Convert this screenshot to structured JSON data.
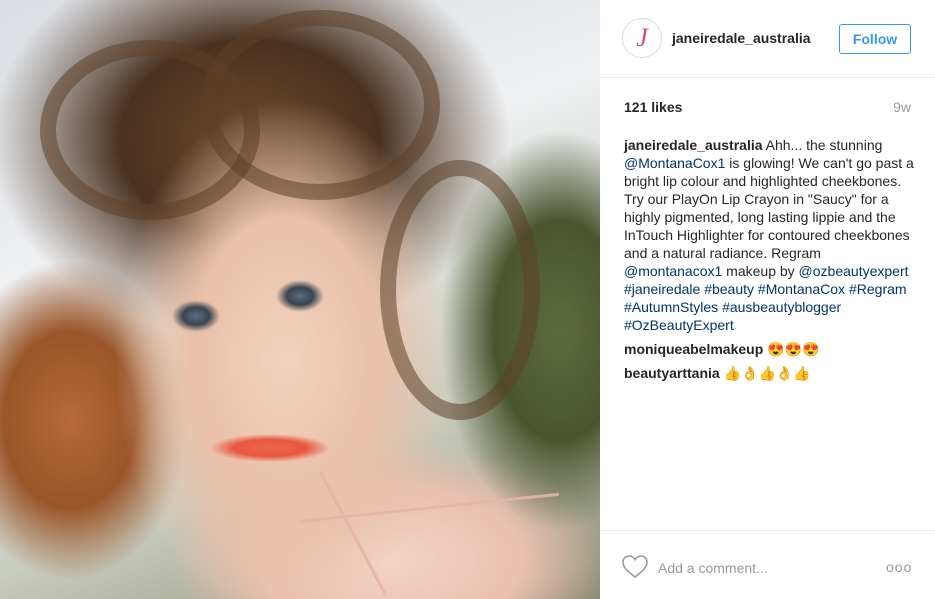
{
  "post": {
    "username": "janeiredale_australia",
    "follow_label": "Follow",
    "likes": "121 likes",
    "age": "9w"
  },
  "caption": {
    "author": "janeiredale_australia",
    "t1": " Ahh... the stunning ",
    "m1": "@MontanaCox1",
    "t2": " is glowing! We can't go past a bright lip colour and highlighted cheekbones. Try our PlayOn Lip Crayon in \"Saucy\" for a highly pigmented, long lasting lippie and the InTouch Highlighter for contoured cheekbones and a natural radiance. Regram ",
    "m2": "@montanacox1",
    "t3": " makeup by ",
    "m3": "@ozbeautyexpert",
    "h1": "#janeiredale",
    "h2": "#beauty",
    "h3": "#MontanaCox",
    "h4": "#Regram",
    "h5": "#AutumnStyles",
    "h6": "#ausbeautyblogger",
    "h7": "#OzBeautyExpert"
  },
  "comments": [
    {
      "author": "moniqueabelmakeup",
      "text": "😍😍😍"
    },
    {
      "author": "beautyarttania",
      "text": "👍👌👍👌👍"
    }
  ],
  "footer": {
    "placeholder": "Add a comment...",
    "more": "ooo"
  },
  "colors": {
    "follow": "#3897f0",
    "link": "#003569",
    "muted": "#999999"
  },
  "icons": {
    "heart": "heart-outline-icon",
    "avatar_logo": "jane-iredale-logo"
  }
}
